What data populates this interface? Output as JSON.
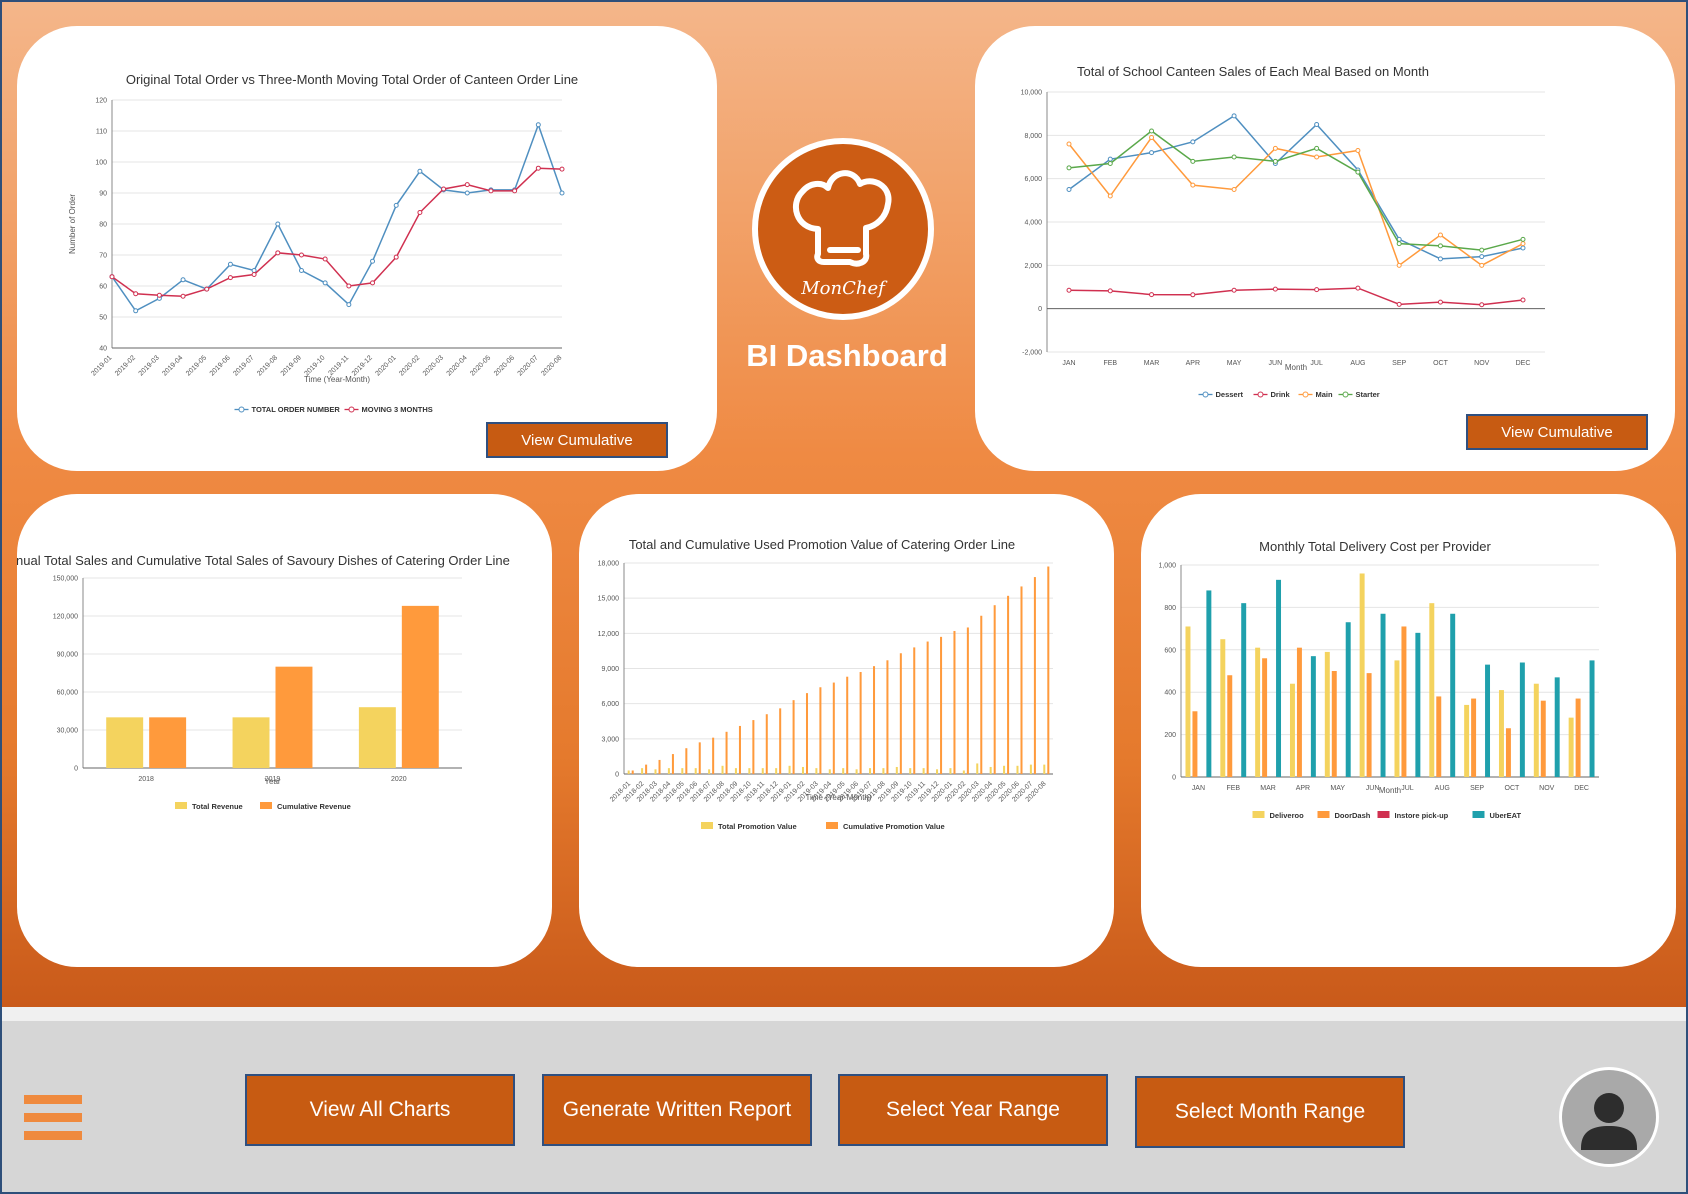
{
  "dashboard": {
    "title": "BI Dashboard",
    "logo_text": "MonChef"
  },
  "cards": {
    "card1": {
      "view_cumulative": "View Cumulative"
    },
    "card2": {
      "view_cumulative": "View Cumulative"
    }
  },
  "bottom_bar": {
    "view_all": "View All Charts",
    "generate_report": "Generate Written Report",
    "select_year": "Select Year Range",
    "select_month": "Select Month Range"
  },
  "colors": {
    "orange": "#ff9a3c",
    "yellow": "#f4d35e",
    "blue": "#4f8fc0",
    "red": "#d03050",
    "green": "#5aa84a",
    "teal": "#1fa0ac",
    "button": "#c75b12"
  },
  "icons": {
    "menu": "hamburger-menu-icon",
    "avatar": "user-avatar-icon",
    "logo": "chef-hat-icon"
  },
  "chart_data": [
    {
      "id": "chart1",
      "type": "line",
      "title": "Original Total Order vs Three-Month Moving Total Order of Canteen Order Line",
      "xlabel": "Time (Year-Month)",
      "ylabel": "Number of Order",
      "ylim": [
        40,
        120
      ],
      "yticks": [
        40,
        50,
        60,
        70,
        80,
        90,
        100,
        110,
        120
      ],
      "categories": [
        "2019-01",
        "2019-02",
        "2019-03",
        "2019-04",
        "2019-05",
        "2019-06",
        "2019-07",
        "2019-08",
        "2019-09",
        "2019-10",
        "2019-11",
        "2019-12",
        "2020-01",
        "2020-02",
        "2020-03",
        "2020-04",
        "2020-05",
        "2020-06",
        "2020-07",
        "2020-08"
      ],
      "legend_position": "bottom",
      "series": [
        {
          "name": "TOTAL ORDER NUMBER",
          "color": "#4f8fc0",
          "values": [
            63,
            52,
            56,
            62,
            59,
            67,
            65,
            80,
            65,
            61,
            54,
            68,
            86,
            97,
            91,
            90,
            91,
            91,
            112,
            90
          ]
        },
        {
          "name": "MOVING 3 MONTHS",
          "color": "#d03050",
          "values": [
            63,
            57.5,
            57,
            56.7,
            59,
            62.7,
            63.7,
            70.7,
            70,
            68.7,
            60,
            61,
            69.3,
            83.7,
            91.3,
            92.7,
            90.7,
            90.7,
            98,
            97.7
          ]
        }
      ]
    },
    {
      "id": "chart2",
      "type": "line",
      "title": "Total of School Canteen Sales of Each Meal Based on Month",
      "xlabel": "Month",
      "ylabel": "",
      "ylim": [
        -2000,
        10000
      ],
      "yticks": [
        -2000,
        0,
        2000,
        4000,
        6000,
        8000,
        10000
      ],
      "ytick_labels": [
        "-2,000",
        "0",
        "2,000",
        "4,000",
        "6,000",
        "8,000",
        "10,000"
      ],
      "categories": [
        "JAN",
        "FEB",
        "MAR",
        "APR",
        "MAY",
        "JUN",
        "JUL",
        "AUG",
        "SEP",
        "OCT",
        "NOV",
        "DEC"
      ],
      "legend_position": "bottom",
      "series": [
        {
          "name": "Dessert",
          "color": "#4f8fc0",
          "values": [
            5500,
            6900,
            7200,
            7700,
            8900,
            6700,
            8500,
            6400,
            3200,
            2300,
            2400,
            2800
          ]
        },
        {
          "name": "Drink",
          "color": "#d03050",
          "values": [
            850,
            820,
            650,
            640,
            850,
            900,
            880,
            950,
            200,
            300,
            180,
            400
          ]
        },
        {
          "name": "Main",
          "color": "#ff9a3c",
          "values": [
            7600,
            5200,
            7900,
            5700,
            5500,
            7400,
            7000,
            7300,
            2000,
            3400,
            2000,
            3000
          ]
        },
        {
          "name": "Starter",
          "color": "#5aa84a",
          "values": [
            6500,
            6700,
            8200,
            6800,
            7000,
            6800,
            7400,
            6300,
            3000,
            2900,
            2700,
            3200
          ]
        }
      ]
    },
    {
      "id": "chart3",
      "type": "bar",
      "title": "Annual Total Sales and Cumulative Total Sales of Savoury Dishes of Catering Order Line",
      "xlabel": "Year",
      "ylabel": "",
      "ylim": [
        0,
        150000
      ],
      "yticks": [
        0,
        30000,
        60000,
        90000,
        120000,
        150000
      ],
      "ytick_labels": [
        "0",
        "30,000",
        "60,000",
        "90,000",
        "120,000",
        "150,000"
      ],
      "categories": [
        "2018",
        "2019",
        "2020"
      ],
      "legend_position": "bottom",
      "series": [
        {
          "name": "Total Revenue",
          "color": "#f4d35e",
          "values": [
            40000,
            40000,
            48000
          ]
        },
        {
          "name": "Cumulative Revenue",
          "color": "#ff9a3c",
          "values": [
            40000,
            80000,
            128000
          ]
        }
      ]
    },
    {
      "id": "chart4",
      "type": "bar",
      "title": "Total and Cumulative Used Promotion Value of Catering Order Line",
      "xlabel": "Time (Year-Month)",
      "ylabel": "",
      "ylim": [
        0,
        18000
      ],
      "yticks": [
        0,
        3000,
        6000,
        9000,
        12000,
        15000,
        18000
      ],
      "ytick_labels": [
        "0",
        "3,000",
        "6,000",
        "9,000",
        "12,000",
        "15,000",
        "18,000"
      ],
      "categories": [
        "2018-01",
        "2018-02",
        "2018-03",
        "2018-04",
        "2018-05",
        "2018-06",
        "2018-07",
        "2018-08",
        "2018-09",
        "2018-10",
        "2018-11",
        "2018-12",
        "2019-01",
        "2019-02",
        "2019-03",
        "2019-04",
        "2019-05",
        "2019-06",
        "2019-07",
        "2019-08",
        "2019-09",
        "2019-10",
        "2019-11",
        "2019-12",
        "2020-01",
        "2020-02",
        "2020-03",
        "2020-04",
        "2020-05",
        "2020-06",
        "2020-07",
        "2020-08"
      ],
      "legend_position": "bottom",
      "series": [
        {
          "name": "Total Promotion Value",
          "color": "#f4d35e",
          "values": [
            300,
            500,
            400,
            500,
            500,
            500,
            400,
            700,
            500,
            500,
            500,
            500,
            700,
            600,
            500,
            400,
            500,
            400,
            500,
            500,
            600,
            500,
            500,
            400,
            500,
            300,
            900,
            600,
            700,
            700,
            800,
            800
          ]
        },
        {
          "name": "Cumulative Promotion Value",
          "color": "#ff9a3c",
          "values": [
            300,
            800,
            1200,
            1700,
            2200,
            2700,
            3100,
            3600,
            4100,
            4600,
            5100,
            5600,
            6300,
            6900,
            7400,
            7800,
            8300,
            8700,
            9200,
            9700,
            10300,
            10800,
            11300,
            11700,
            12200,
            12500,
            13500,
            14400,
            15200,
            16000,
            16800,
            17700
          ]
        }
      ]
    },
    {
      "id": "chart5",
      "type": "bar",
      "title": "Monthly Total Delivery Cost per Provider",
      "xlabel": "Month",
      "ylabel": "",
      "ylim": [
        0,
        1000
      ],
      "yticks": [
        0,
        200,
        400,
        600,
        800,
        1000
      ],
      "ytick_labels": [
        "0",
        "200",
        "400",
        "600",
        "800",
        "1,000"
      ],
      "categories": [
        "JAN",
        "FEB",
        "MAR",
        "APR",
        "MAY",
        "JUN",
        "JUL",
        "AUG",
        "SEP",
        "OCT",
        "NOV",
        "DEC"
      ],
      "legend_position": "bottom",
      "series": [
        {
          "name": "Deliveroo",
          "color": "#f4d35e",
          "values": [
            710,
            650,
            610,
            440,
            590,
            960,
            550,
            820,
            340,
            410,
            440,
            280
          ]
        },
        {
          "name": "DoorDash",
          "color": "#ff9a3c",
          "values": [
            310,
            480,
            560,
            610,
            500,
            490,
            710,
            380,
            370,
            230,
            360,
            370
          ]
        },
        {
          "name": "Instore pick-up",
          "color": "#d03050",
          "values": [
            0,
            0,
            0,
            0,
            0,
            0,
            0,
            0,
            0,
            0,
            0,
            0
          ]
        },
        {
          "name": "UberEAT",
          "color": "#1fa0ac",
          "values": [
            880,
            820,
            930,
            570,
            730,
            770,
            680,
            770,
            530,
            540,
            470,
            550
          ]
        }
      ]
    }
  ]
}
